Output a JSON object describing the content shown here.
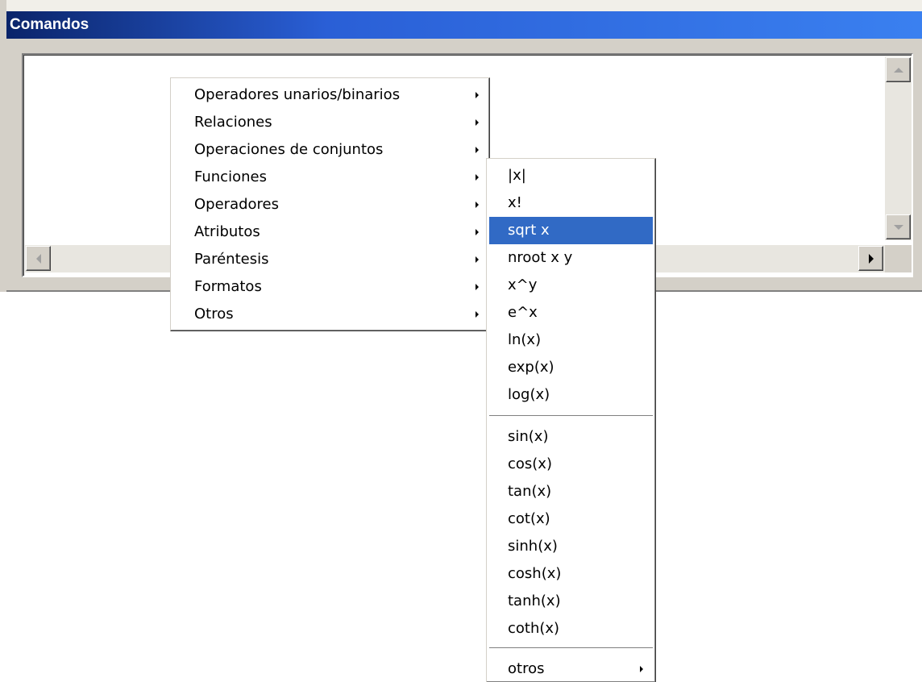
{
  "window": {
    "title": "Comandos"
  },
  "main_menu": {
    "items": [
      {
        "label": "Operadores unarios/binarios",
        "submenu": true
      },
      {
        "label": "Relaciones",
        "submenu": true
      },
      {
        "label": "Operaciones de conjuntos",
        "submenu": true
      },
      {
        "label": "Funciones",
        "submenu": true
      },
      {
        "label": "Operadores",
        "submenu": true
      },
      {
        "label": "Atributos",
        "submenu": true
      },
      {
        "label": "Paréntesis",
        "submenu": true
      },
      {
        "label": "Formatos",
        "submenu": true
      },
      {
        "label": "Otros",
        "submenu": true
      }
    ]
  },
  "functions_menu": {
    "items": [
      {
        "label": "|x|"
      },
      {
        "label": "x!"
      },
      {
        "label": "sqrt x",
        "highlighted": true
      },
      {
        "label": "nroot x y"
      },
      {
        "label": "x^y"
      },
      {
        "label": "e^x"
      },
      {
        "label": "ln(x)"
      },
      {
        "label": "exp(x)"
      },
      {
        "label": "log(x)"
      },
      {
        "label": "sin(x)"
      },
      {
        "label": "cos(x)"
      },
      {
        "label": "tan(x)"
      },
      {
        "label": "cot(x)"
      },
      {
        "label": "sinh(x)"
      },
      {
        "label": "cosh(x)"
      },
      {
        "label": "tanh(x)"
      },
      {
        "label": "coth(x)"
      },
      {
        "label": "otros",
        "submenu": true
      }
    ]
  },
  "colors": {
    "titlebar_start": "#0a246a",
    "titlebar_end": "#3a80f0",
    "highlight": "#316ac5",
    "face": "#d4d0c8"
  }
}
